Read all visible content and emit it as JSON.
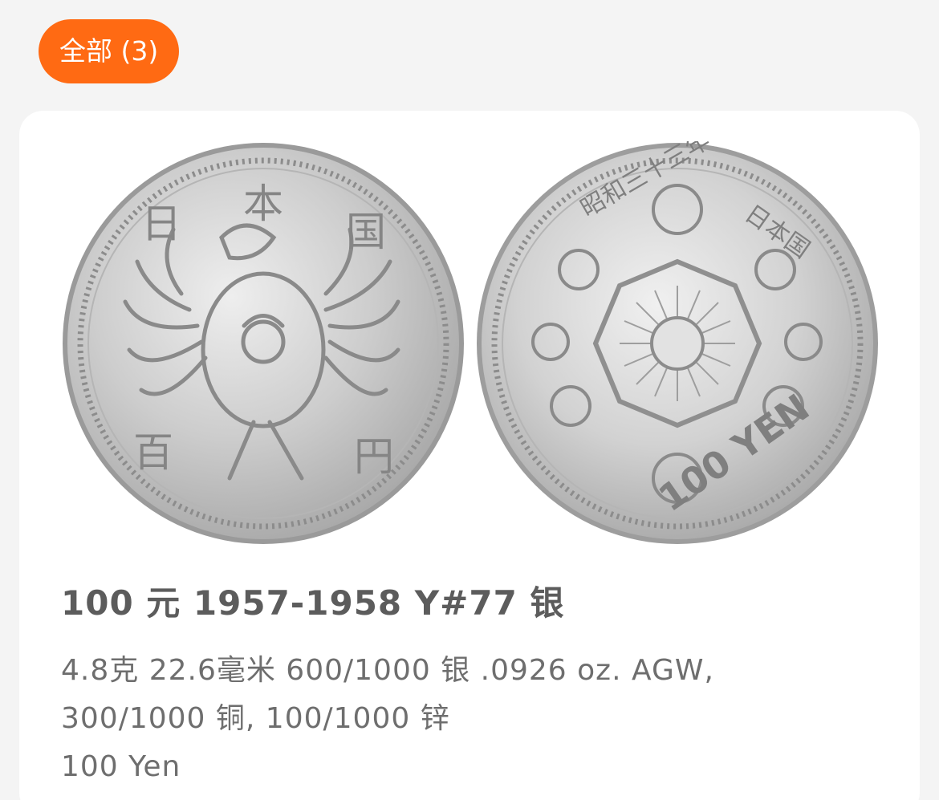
{
  "filter": {
    "label": "全部 (3)"
  },
  "coin": {
    "title": "100 元  1957-1958  Y#77  银",
    "spec_line1": "4.8克  22.6毫米  600/1000 银 .0926 oz. AGW,",
    "spec_line2": "300/1000 铜, 100/1000 锌",
    "spec_line3": "100 Yen",
    "obverse_legend": [
      "日",
      "本",
      "国",
      "百",
      "円"
    ],
    "reverse_legend_left": "昭和三十三年",
    "reverse_legend_right": "日本国",
    "reverse_denomination": "100 YEN"
  },
  "colors": {
    "accent": "#ff6a13",
    "title_text": "#5c5c5c",
    "body_text": "#6e6e6e",
    "page_bg": "#f4f4f4",
    "card_bg": "#ffffff"
  }
}
